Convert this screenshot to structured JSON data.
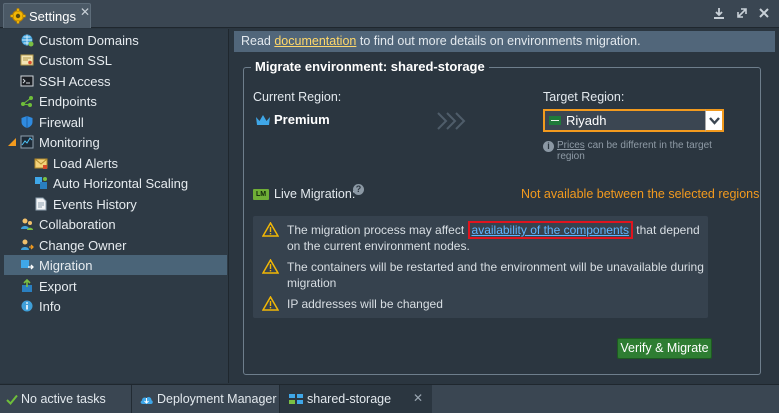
{
  "window": {
    "tab_title": "Settings",
    "close_glyph": "✕"
  },
  "sidebar": {
    "items": [
      {
        "label": "Custom Domains",
        "icon": "globe-icon"
      },
      {
        "label": "Custom SSL",
        "icon": "certificate-icon"
      },
      {
        "label": "SSH Access",
        "icon": "terminal-icon"
      },
      {
        "label": "Endpoints",
        "icon": "endpoints-icon"
      },
      {
        "label": "Firewall",
        "icon": "shield-icon"
      },
      {
        "label": "Monitoring",
        "icon": "monitor-icon"
      },
      {
        "label": "Load Alerts",
        "icon": "envelope-icon"
      },
      {
        "label": "Auto Horizontal Scaling",
        "icon": "scaling-icon"
      },
      {
        "label": "Events History",
        "icon": "document-icon"
      },
      {
        "label": "Collaboration",
        "icon": "users-icon"
      },
      {
        "label": "Change Owner",
        "icon": "user-transfer-icon"
      },
      {
        "label": "Migration",
        "icon": "migration-icon"
      },
      {
        "label": "Export",
        "icon": "export-icon"
      },
      {
        "label": "Info",
        "icon": "info-icon"
      }
    ],
    "active": "Migration"
  },
  "info_bar": {
    "prefix": "Read ",
    "link": "documentation",
    "suffix": " to find out more details on environments migration."
  },
  "migrate": {
    "title": "Migrate environment: shared-storage",
    "current_region_label": "Current Region:",
    "current_region_value": "Premium",
    "target_region_label": "Target Region:",
    "target_region_value": "Riyadh",
    "prices_link": "Prices",
    "prices_hint": " can be different in the target region",
    "live_badge": "LM",
    "live_label": "Live Migration:",
    "help_glyph": "?",
    "live_status": "Not available between the selected regions",
    "warnings": {
      "w1_prefix": "The migration process may affect ",
      "w1_link": "availability of the components",
      "w1_suffix": " that depend on the current environment nodes.",
      "w2": "The containers will be restarted and the environment will be unavailable during migration",
      "w3": "IP addresses will be changed"
    },
    "verify_button": "Verify & Migrate"
  },
  "taskbar": {
    "tasks_status": "No active tasks",
    "deployment_manager": "Deployment Manager",
    "env_tab": "shared-storage",
    "close_glyph": "✕"
  },
  "colors": {
    "accent_orange": "#f29a1e",
    "link_yellow": "#ffd86a",
    "link_blue": "#5fb4ff",
    "button_green": "#2e7d32",
    "highlight_red": "#e0141e"
  }
}
